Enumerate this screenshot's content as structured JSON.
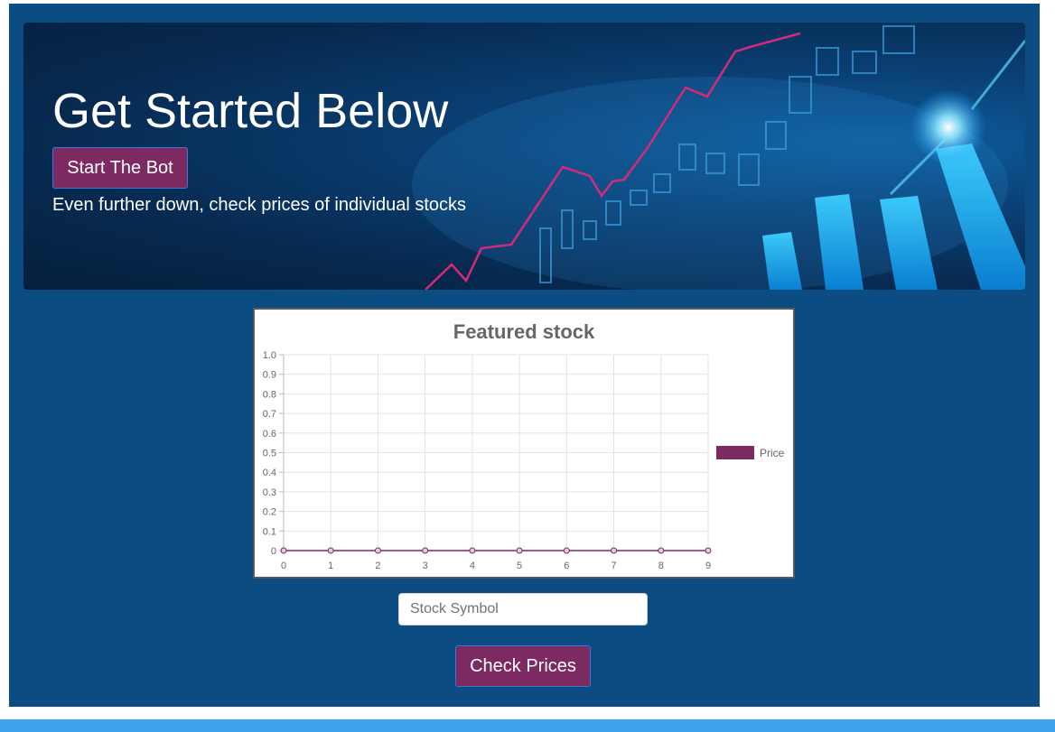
{
  "hero": {
    "title": "Get Started Below",
    "start_button": "Start The Bot",
    "subtitle": "Even further down, check prices of individual stocks"
  },
  "chart_data": {
    "type": "line",
    "title": "Featured stock",
    "x": [
      0,
      1,
      2,
      3,
      4,
      5,
      6,
      7,
      8,
      9
    ],
    "series": [
      {
        "name": "Price",
        "values": [
          0,
          0,
          0,
          0,
          0,
          0,
          0,
          0,
          0,
          0
        ]
      }
    ],
    "yticks": [
      "0",
      "0.1",
      "0.2",
      "0.3",
      "0.4",
      "0.5",
      "0.6",
      "0.7",
      "0.8",
      "0.9",
      "1.0"
    ],
    "ylim": [
      0,
      1
    ],
    "xlim": [
      0,
      9
    ],
    "grid": true,
    "legend": "right",
    "colors": {
      "series": "#7d2a63",
      "point_stroke": "#7d2a63"
    }
  },
  "search": {
    "placeholder": "Stock Symbol",
    "value": "",
    "button": "Check Prices"
  },
  "colors": {
    "page_bg": "#0b4d82",
    "accent_button": "#7d2a63",
    "bottom_bar": "#3ea3ee"
  }
}
